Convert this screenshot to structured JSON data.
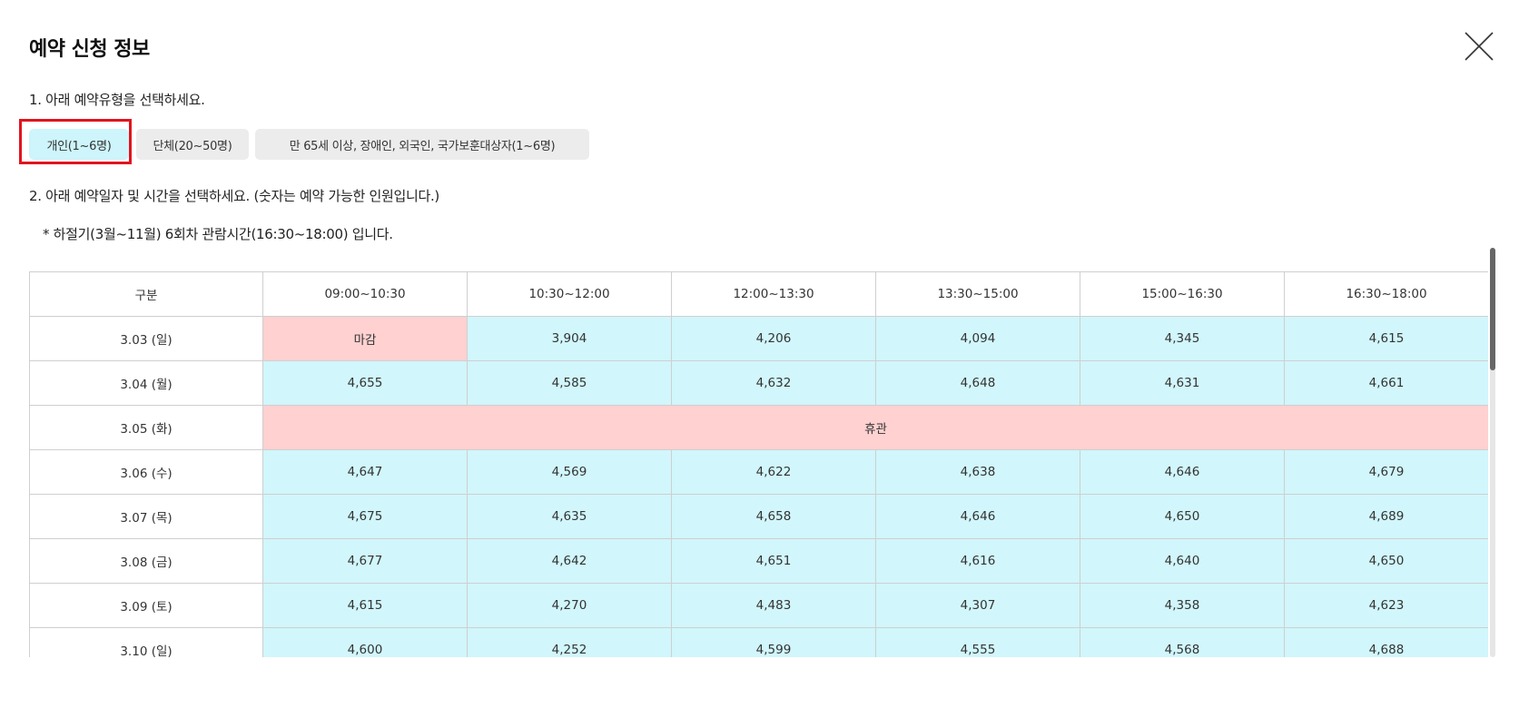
{
  "modal": {
    "title": "예약 신청 정보",
    "step1_text": "1. 아래 예약유형을 선택하세요.",
    "step2_text": "2. 아래 예약일자 및 시간을 선택하세요. (숫자는 예약 가능한 인원입니다.)",
    "note_text": "* 하절기(3월~11월) 6회차 관람시간(16:30~18:00) 입니다."
  },
  "reservation_types": [
    {
      "label": "개인(1~6명)",
      "selected": true
    },
    {
      "label": "단체(20~50명)",
      "selected": false
    },
    {
      "label": "만 65세 이상, 장애인, 외국인, 국가보훈대상자(1~6명)",
      "selected": false
    }
  ],
  "colors": {
    "available": "#d1f6fb",
    "closed": "#ffd1d1",
    "selected_type": "#cdf5fb",
    "selection_outline": "#e0141e"
  },
  "table": {
    "headers": [
      "구분",
      "09:00~10:30",
      "10:30~12:00",
      "12:00~13:30",
      "13:30~15:00",
      "15:00~16:30",
      "16:30~18:00"
    ],
    "rows": [
      {
        "date": "3.03 (일)",
        "cells": [
          "마감",
          "3,904",
          "4,206",
          "4,094",
          "4,345",
          "4,615"
        ]
      },
      {
        "date": "3.04 (월)",
        "cells": [
          "4,655",
          "4,585",
          "4,632",
          "4,648",
          "4,631",
          "4,661"
        ]
      },
      {
        "date": "3.05 (화)",
        "closed_all_day": "휴관"
      },
      {
        "date": "3.06 (수)",
        "cells": [
          "4,647",
          "4,569",
          "4,622",
          "4,638",
          "4,646",
          "4,679"
        ]
      },
      {
        "date": "3.07 (목)",
        "cells": [
          "4,675",
          "4,635",
          "4,658",
          "4,646",
          "4,650",
          "4,689"
        ]
      },
      {
        "date": "3.08 (금)",
        "cells": [
          "4,677",
          "4,642",
          "4,651",
          "4,616",
          "4,640",
          "4,650"
        ]
      },
      {
        "date": "3.09 (토)",
        "cells": [
          "4,615",
          "4,270",
          "4,483",
          "4,307",
          "4,358",
          "4,623"
        ]
      },
      {
        "date": "3.10 (일)",
        "cells": [
          "4,600",
          "4,252",
          "4,599",
          "4,555",
          "4,568",
          "4,688"
        ]
      }
    ]
  }
}
